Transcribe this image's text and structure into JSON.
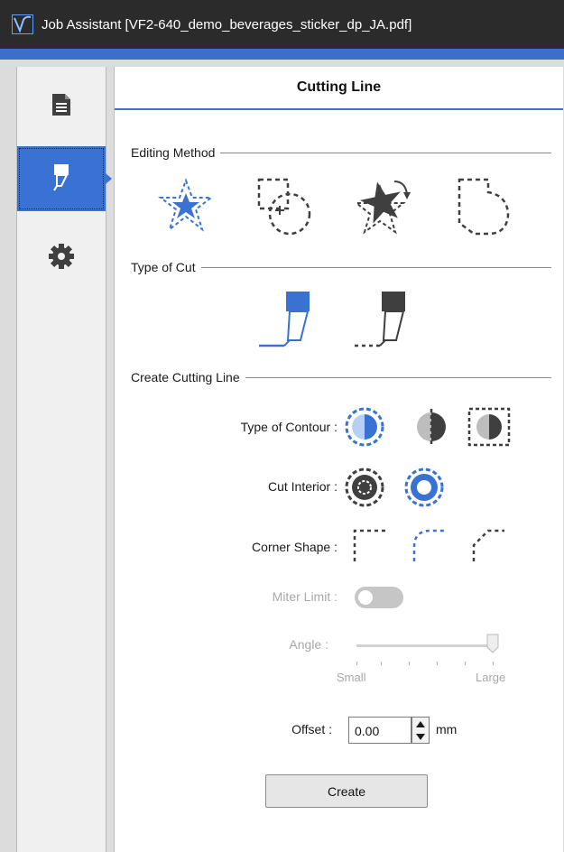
{
  "window": {
    "title": "Job Assistant [VF2-640_demo_beverages_sticker_dp_JA.pdf]"
  },
  "sidebar": {
    "items": [
      {
        "name": "document",
        "icon": "document-icon",
        "active": false
      },
      {
        "name": "cutting",
        "icon": "cutter-icon",
        "active": true
      },
      {
        "name": "settings",
        "icon": "gear-icon",
        "active": false
      }
    ]
  },
  "panel": {
    "title": "Cutting Line",
    "editing_method": {
      "label": "Editing Method",
      "options": [
        "star-outline-icon",
        "offset-circle-icon",
        "rotate-star-icon",
        "freeform-shape-icon"
      ]
    },
    "type_of_cut": {
      "label": "Type of Cut",
      "options": [
        "solid-cut-icon",
        "dashed-cut-icon"
      ],
      "selected": 0
    },
    "create_cutting_line": {
      "label": "Create Cutting Line",
      "type_of_contour": {
        "label": "Type of Contour :",
        "selected": 0
      },
      "cut_interior": {
        "label": "Cut Interior :",
        "selected": 1
      },
      "corner_shape": {
        "label": "Corner Shape :",
        "selected": 1
      },
      "miter_limit": {
        "label": "Miter Limit :",
        "enabled": false,
        "on": false
      },
      "angle": {
        "label": "Angle :",
        "min_label": "Small",
        "max_label": "Large",
        "value_fraction": 1.0,
        "enabled": false
      },
      "offset": {
        "label": "Offset :",
        "value": "0.00",
        "unit": "mm"
      },
      "create_button": "Create"
    }
  },
  "colors": {
    "accent": "#3a72d4",
    "dark_icon": "#3f3f3f",
    "title_bar": "#2b2b2b"
  }
}
